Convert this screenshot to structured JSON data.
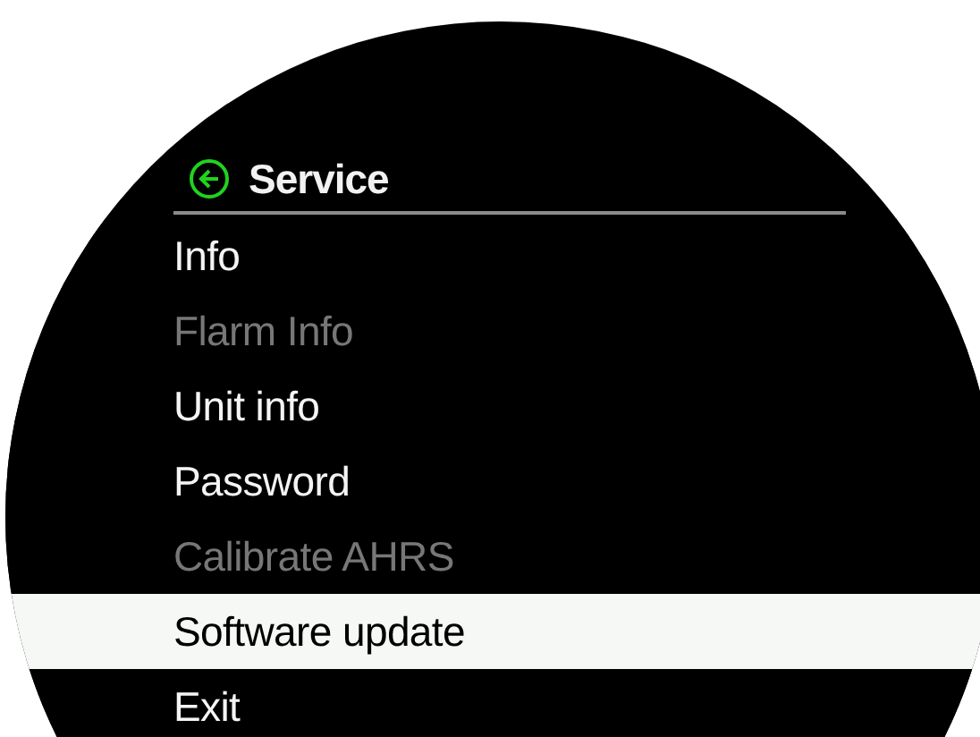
{
  "header": {
    "title": "Service"
  },
  "items": [
    {
      "label": "Info",
      "disabled": false,
      "selected": false
    },
    {
      "label": "Flarm Info",
      "disabled": true,
      "selected": false
    },
    {
      "label": "Unit info",
      "disabled": false,
      "selected": false
    },
    {
      "label": "Password",
      "disabled": false,
      "selected": false
    },
    {
      "label": "Calibrate AHRS",
      "disabled": true,
      "selected": false
    },
    {
      "label": "Software update",
      "disabled": false,
      "selected": true
    },
    {
      "label": "Exit",
      "disabled": false,
      "selected": false
    }
  ]
}
